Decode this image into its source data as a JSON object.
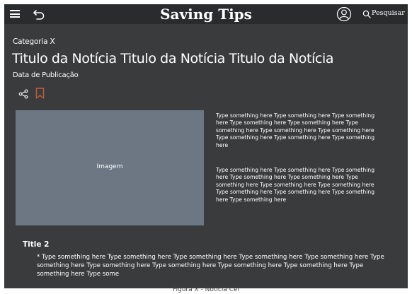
{
  "header": {
    "brand": "Saving Tips",
    "search_label": "Pesquisar",
    "icons": [
      "menu-icon",
      "back-arrow-icon",
      "user-icon",
      "search-icon"
    ]
  },
  "article": {
    "category": "Categoria X",
    "title": "Titulo da Notícia Titulo da Notícia Titulo da Notícia",
    "date": "Data de Publicação",
    "image_label": "Imagem",
    "paragraph1": "Type something here Type something here Type something here Type something here Type something here Type something here Type something here Type something here Type something here Type something here Type something here",
    "paragraph2": "Type something here Type something here Type something here Type something here Type something here Type something here Type something here Type something here Type something here Type something here Type something here Type something here",
    "section_title": "Title 2",
    "bullet": "* Type something here Type something here Type something here Type something here Type something here Type something here Type something here Type something here Type something here Type something here Type something here Type some"
  },
  "caption": "Figura X - Notícia Cel",
  "colors": {
    "background": "#3a3b3d",
    "topbar": "#2a2b2d",
    "image_placeholder": "#6d7784",
    "bookmark_accent": "#c0603a"
  }
}
